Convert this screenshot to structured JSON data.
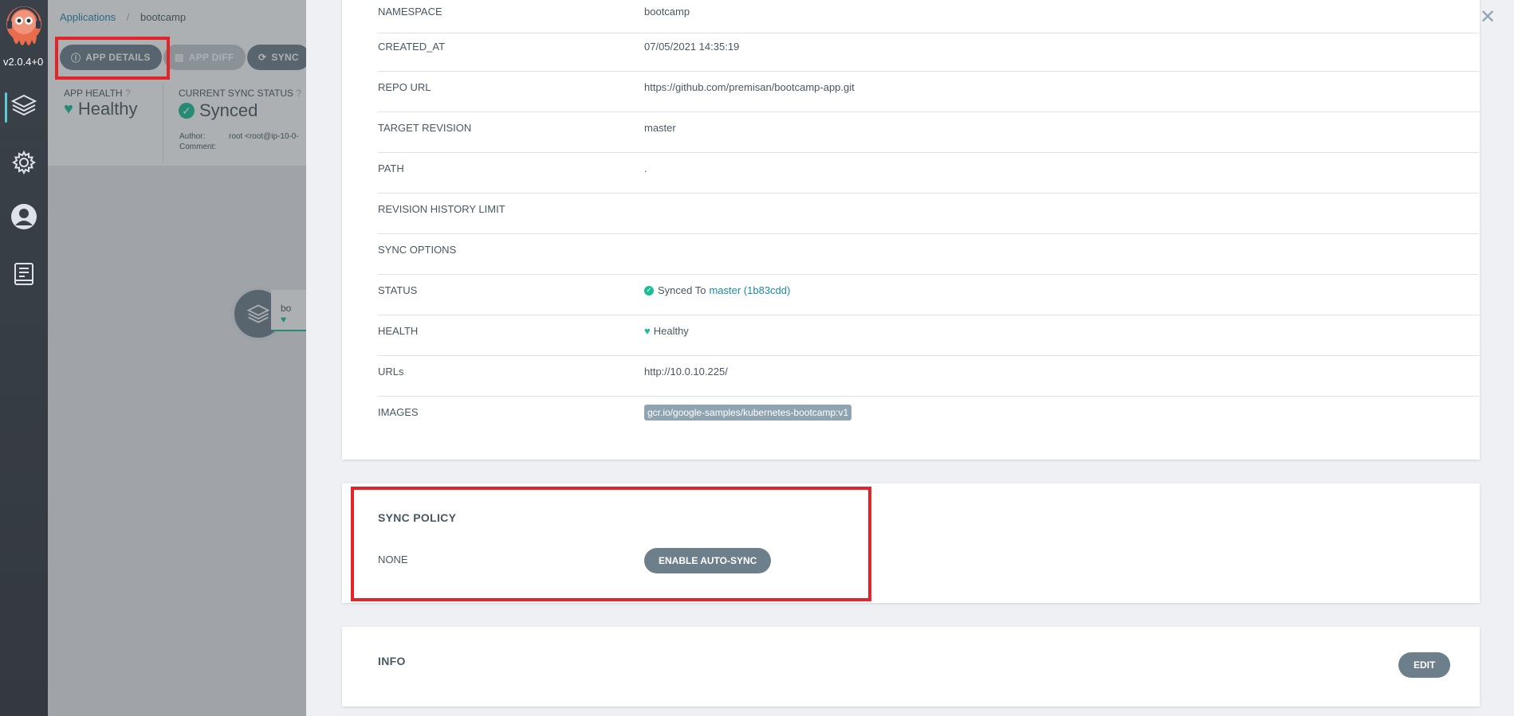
{
  "nav": {
    "version": "v2.0.4+0",
    "items": [
      {
        "name": "applications",
        "icon": "layers-icon"
      },
      {
        "name": "settings",
        "icon": "gear-icon"
      },
      {
        "name": "user-info",
        "icon": "user-icon"
      },
      {
        "name": "documentation",
        "icon": "docs-icon"
      }
    ]
  },
  "breadcrumb": {
    "root": "Applications",
    "current": "bootcamp"
  },
  "toolbar": {
    "app_details": "APP DETAILS",
    "app_diff": "APP DIFF",
    "sync": "SYNC"
  },
  "status": {
    "app_health_label": "APP HEALTH",
    "app_health_value": "Healthy",
    "sync_label": "CURRENT SYNC STATUS",
    "sync_value": "Synced",
    "author_label": "Author:",
    "author_value": "root <root@ip-10-0-",
    "comment_label": "Comment:"
  },
  "graph": {
    "node_label": "bo"
  },
  "details": {
    "rows": [
      {
        "key": "NAMESPACE",
        "value": "bootcamp"
      },
      {
        "key": "CREATED_AT",
        "value": "07/05/2021 14:35:19"
      },
      {
        "key": "REPO URL",
        "value": "https://github.com/premisan/bootcamp-app.git"
      },
      {
        "key": "TARGET REVISION",
        "value": "master"
      },
      {
        "key": "PATH",
        "value": "."
      },
      {
        "key": "REVISION HISTORY LIMIT",
        "value": ""
      },
      {
        "key": "SYNC OPTIONS",
        "value": ""
      },
      {
        "key": "STATUS",
        "value_prefix": "Synced To",
        "value": "master (1b83cdd)"
      },
      {
        "key": "HEALTH",
        "value": "Healthy"
      },
      {
        "key": "URLs",
        "value": "http://10.0.10.225/"
      },
      {
        "key": "IMAGES",
        "value": "gcr.io/google-samples/kubernetes-bootcamp:v1"
      }
    ]
  },
  "sync_policy": {
    "title": "SYNC POLICY",
    "label": "NONE",
    "button": "ENABLE AUTO-SYNC"
  },
  "info": {
    "title": "INFO",
    "edit_button": "EDIT"
  },
  "colors": {
    "healthy": "#18be94",
    "link": "#1e88a8",
    "button": "#6d7f8b",
    "highlight": "#e3242b"
  }
}
